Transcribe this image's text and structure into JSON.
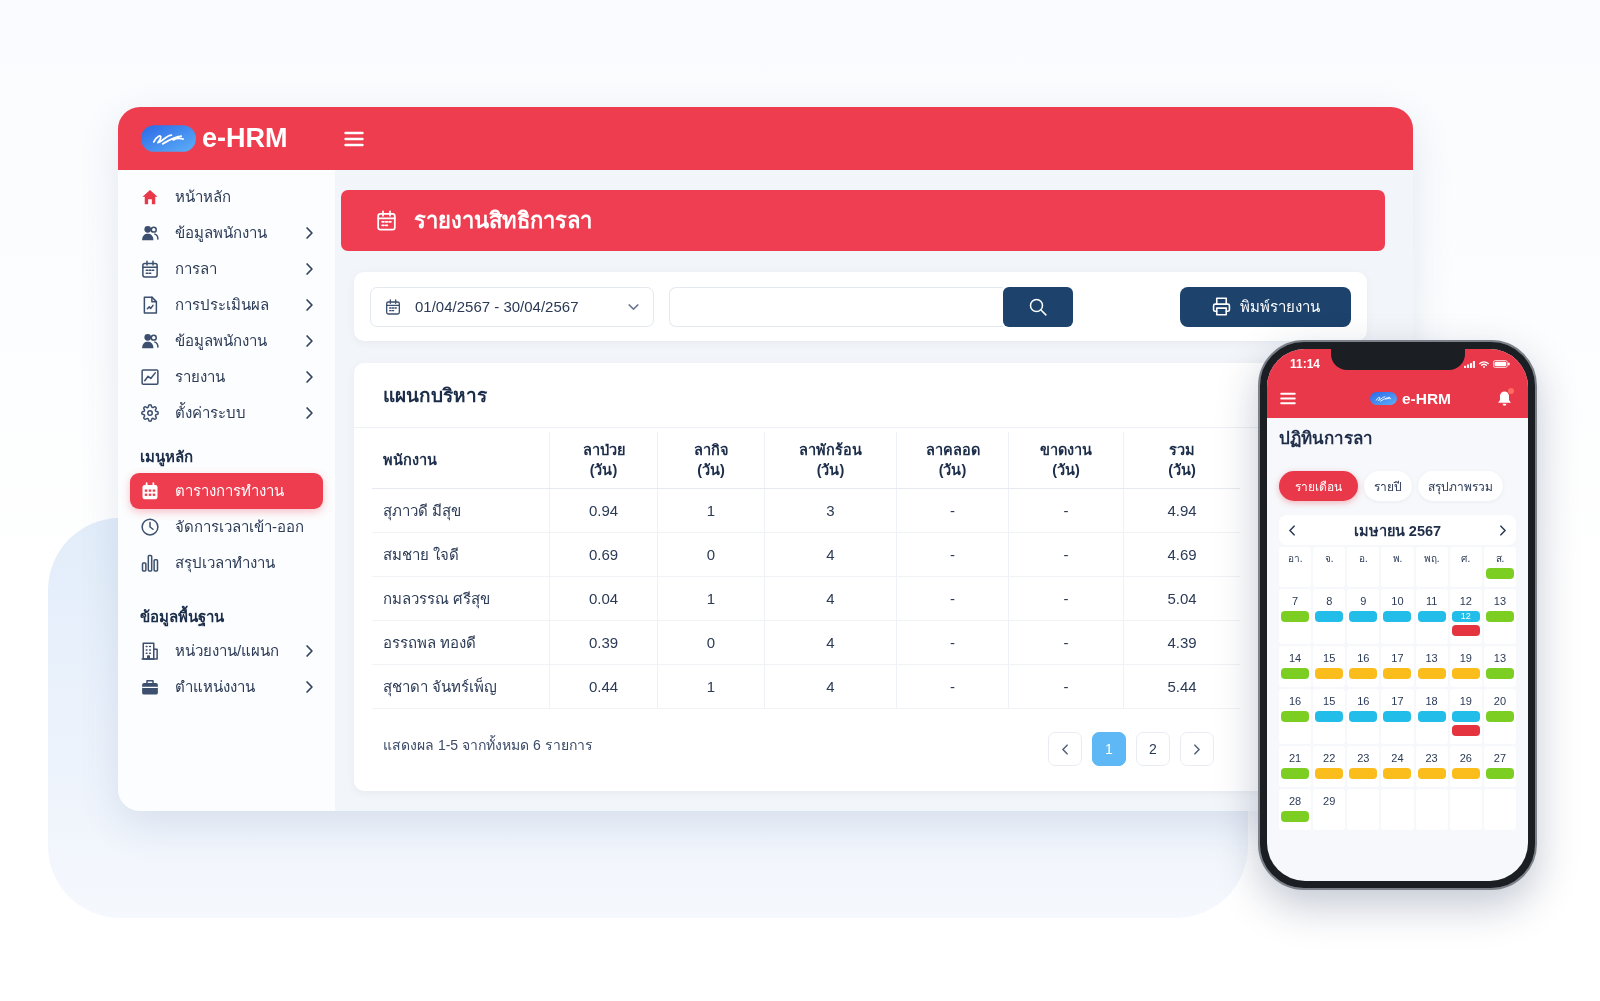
{
  "app": {
    "logo_text": "e-HRM"
  },
  "sidebar": {
    "sections": [
      {
        "items": [
          {
            "label": "หน้าหลัก",
            "expandable": false,
            "selected": false
          },
          {
            "label": "ข้อมูลพนักงาน",
            "expandable": true,
            "selected": false
          },
          {
            "label": "การลา",
            "expandable": true,
            "selected": false
          },
          {
            "label": "การประเมินผล",
            "expandable": true,
            "selected": false
          },
          {
            "label": "ข้อมูลพนักงาน",
            "expandable": true,
            "selected": false
          },
          {
            "label": "รายงาน",
            "expandable": true,
            "selected": false
          },
          {
            "label": "ตั้งค่าระบบ",
            "expandable": true,
            "selected": false
          }
        ]
      },
      {
        "title": "เมนูหลัก",
        "items": [
          {
            "label": "ตารางการทำงาน",
            "expandable": false,
            "selected": true
          },
          {
            "label": "จัดการเวลาเข้า-ออก",
            "expandable": false,
            "selected": false
          },
          {
            "label": "สรุปเวลาทำงาน",
            "expandable": false,
            "selected": false
          }
        ]
      },
      {
        "title": "ข้อมูลพื้นฐาน",
        "items": [
          {
            "label": "หน่วยงาน/แผนก",
            "expandable": true,
            "selected": false
          },
          {
            "label": "ตำแหน่งงาน",
            "expandable": true,
            "selected": false
          }
        ]
      }
    ]
  },
  "page": {
    "title": "รายงานสิทธิการลา"
  },
  "filters": {
    "date_range": "01/04/2567 - 30/04/2567",
    "print_button": "พิมพ์รายงาน"
  },
  "table": {
    "title": "แผนกบริหาร",
    "columns": [
      {
        "label": "พนักงาน"
      },
      {
        "label": "ลาป่วย",
        "unit": "(วัน)"
      },
      {
        "label": "ลากิจ",
        "unit": "(วัน)"
      },
      {
        "label": "ลาพักร้อน",
        "unit": "(วัน)"
      },
      {
        "label": "ลาคลอด",
        "unit": "(วัน)"
      },
      {
        "label": "ขาดงาน",
        "unit": "(วัน)"
      },
      {
        "label": "รวม",
        "unit": "(วัน)"
      }
    ],
    "rows": [
      [
        "สุภาวดี มีสุข",
        "0.94",
        "1",
        "3",
        "-",
        "-",
        "4.94"
      ],
      [
        "สมชาย ใจดี",
        "0.69",
        "0",
        "4",
        "-",
        "-",
        "4.69"
      ],
      [
        "กมลวรรณ ศรีสุข",
        "0.04",
        "1",
        "4",
        "-",
        "-",
        "5.04"
      ],
      [
        "อรรถพล ทองดี",
        "0.39",
        "0",
        "4",
        "-",
        "-",
        "4.39"
      ],
      [
        "สุชาดา จันทร์เพ็ญ",
        "0.44",
        "1",
        "4",
        "-",
        "-",
        "5.44"
      ]
    ],
    "summary": "แสดงผล 1-5 จากทั้งหมด 6 รายการ",
    "pages": [
      {
        "label": "1",
        "selected": true
      },
      {
        "label": "2",
        "selected": false
      }
    ]
  },
  "phone": {
    "time": "11:14",
    "app_title": "e-HRM",
    "has_notification": true,
    "title": "ปฏิทินการลา",
    "tabs": [
      {
        "label": "รายเดือน",
        "selected": true
      },
      {
        "label": "รายปี",
        "selected": false
      },
      {
        "label": "สรุปภาพรวม",
        "selected": false
      }
    ],
    "calendar": {
      "month": "เมษายน 2567",
      "weekdays": [
        {
          "label": "อา."
        },
        {
          "label": "จ."
        },
        {
          "label": "อ."
        },
        {
          "label": "พ."
        },
        {
          "label": "พฤ."
        },
        {
          "label": "ศ."
        },
        {
          "label": "ส.",
          "events": [
            {
              "color": "#7ccf22"
            }
          ]
        }
      ],
      "weeks": [
        [
          {
            "day": "7",
            "events": [
              {
                "color": "#7ccf22"
              }
            ]
          },
          {
            "day": "8",
            "events": [
              {
                "color": "#22bde8"
              }
            ]
          },
          {
            "day": "9",
            "events": [
              {
                "color": "#22bde8"
              }
            ]
          },
          {
            "day": "10",
            "events": [
              {
                "color": "#22bde8"
              }
            ]
          },
          {
            "day": "11",
            "events": [
              {
                "color": "#22bde8"
              }
            ]
          },
          {
            "day": "12",
            "events": [
              {
                "color": "#22bde8",
                "label": "12"
              },
              {
                "color": "#e3343f"
              }
            ]
          },
          {
            "day": "13",
            "events": [
              {
                "color": "#7ccf22"
              }
            ]
          }
        ],
        [
          {
            "day": "14",
            "events": [
              {
                "color": "#7ccf22"
              }
            ]
          },
          {
            "day": "15",
            "events": [
              {
                "color": "#fbbd1c"
              }
            ]
          },
          {
            "day": "16",
            "events": [
              {
                "color": "#fbbd1c"
              }
            ]
          },
          {
            "day": "17",
            "events": [
              {
                "color": "#fbbd1c"
              }
            ]
          },
          {
            "day": "13",
            "events": [
              {
                "color": "#fbbd1c"
              }
            ]
          },
          {
            "day": "19",
            "events": [
              {
                "color": "#fbbd1c"
              }
            ]
          },
          {
            "day": "13",
            "events": [
              {
                "color": "#7ccf22"
              }
            ]
          }
        ],
        [
          {
            "day": "16",
            "events": [
              {
                "color": "#7ccf22"
              }
            ]
          },
          {
            "day": "15",
            "events": [
              {
                "color": "#22bde8"
              }
            ]
          },
          {
            "day": "16",
            "events": [
              {
                "color": "#22bde8"
              }
            ]
          },
          {
            "day": "17",
            "events": [
              {
                "color": "#22bde8"
              }
            ]
          },
          {
            "day": "18",
            "events": [
              {
                "color": "#22bde8"
              }
            ]
          },
          {
            "day": "19",
            "events": [
              {
                "color": "#22bde8"
              },
              {
                "color": "#e3343f"
              }
            ]
          },
          {
            "day": "20",
            "events": [
              {
                "color": "#7ccf22"
              }
            ]
          }
        ],
        [
          {
            "day": "21",
            "events": [
              {
                "color": "#7ccf22"
              }
            ]
          },
          {
            "day": "22",
            "events": [
              {
                "color": "#fbbd1c"
              }
            ]
          },
          {
            "day": "23",
            "events": [
              {
                "color": "#fbbd1c"
              }
            ]
          },
          {
            "day": "24",
            "events": [
              {
                "color": "#fbbd1c"
              }
            ]
          },
          {
            "day": "23",
            "events": [
              {
                "color": "#fbbd1c"
              }
            ]
          },
          {
            "day": "26",
            "events": [
              {
                "color": "#fbbd1c"
              }
            ]
          },
          {
            "day": "27",
            "events": [
              {
                "color": "#7ccf22"
              }
            ]
          }
        ],
        [
          {
            "day": "28",
            "events": [
              {
                "color": "#7ccf22"
              }
            ]
          },
          {
            "day": "29"
          }
        ]
      ]
    }
  }
}
